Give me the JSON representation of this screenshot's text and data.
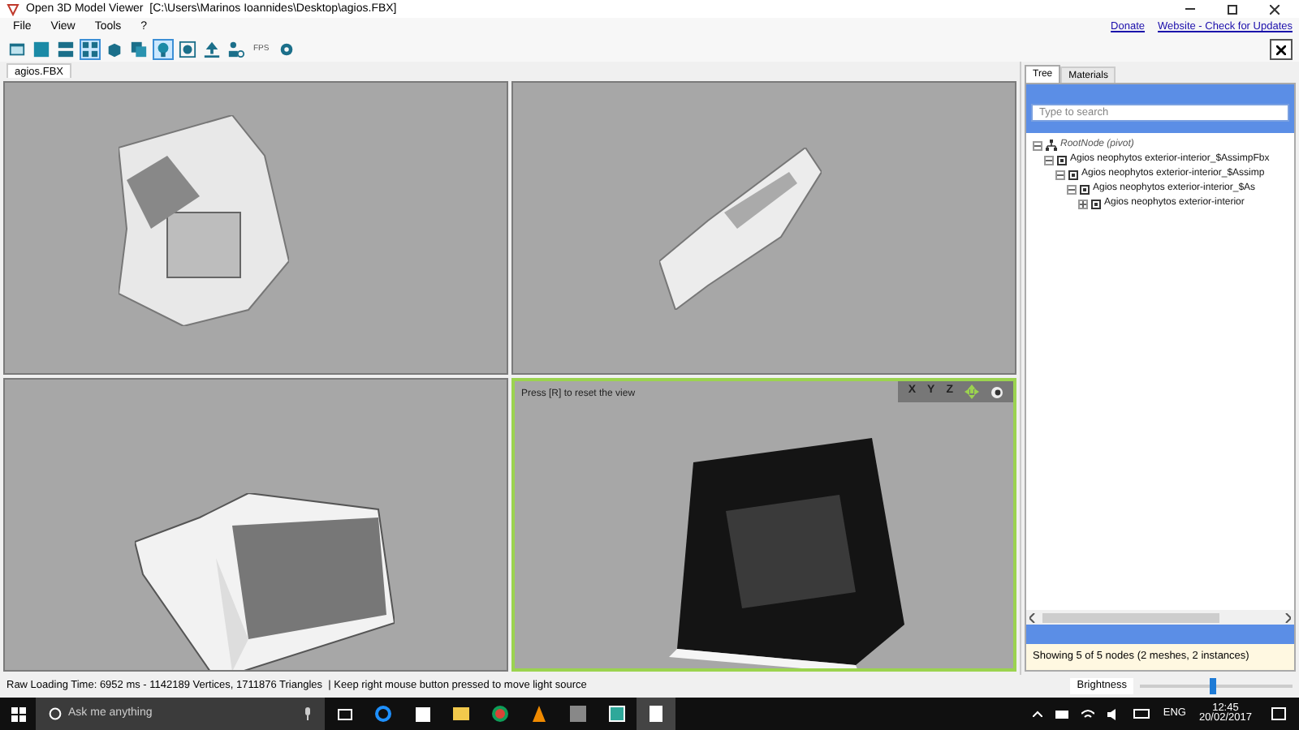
{
  "window": {
    "title": "Open 3D Model Viewer  [C:\\Users\\Marinos Ioannides\\Desktop\\agios.FBX]"
  },
  "menu": [
    "File",
    "View",
    "Tools",
    "?"
  ],
  "toolbar": [
    {
      "kind": "folder",
      "selected": false
    },
    {
      "kind": "single",
      "selected": false
    },
    {
      "kind": "double",
      "selected": false
    },
    {
      "kind": "quad",
      "selected": true
    },
    {
      "kind": "cube",
      "selected": false
    },
    {
      "kind": "cubes",
      "selected": false
    },
    {
      "kind": "bulb",
      "selected": true
    },
    {
      "kind": "frame",
      "selected": false
    },
    {
      "kind": "upload",
      "selected": false
    },
    {
      "kind": "person",
      "selected": false
    },
    {
      "kind": "text",
      "label": "FPS",
      "selected": false
    },
    {
      "kind": "gear",
      "selected": false
    }
  ],
  "links": [
    "Donate",
    "Website - Check for Updates"
  ],
  "document_tab": {
    "label": "agios.FBX"
  },
  "viewports": [
    {
      "active": false
    },
    {
      "active": false
    },
    {
      "active": false
    },
    {
      "active": true,
      "hint": "Press [R] to reset the view",
      "axes": [
        "X",
        "Y",
        "Z"
      ]
    }
  ],
  "panel": {
    "tabs": [
      {
        "label": "Tree",
        "selected": true
      },
      {
        "label": "Materials",
        "selected": false
      }
    ],
    "search": {
      "placeholder": "Type to search"
    },
    "tree": [
      {
        "label": "RootNode (pivot)",
        "kind": "root",
        "expanded": true,
        "children": [
          {
            "label": "Agios neophytos exterior-interior_$AssimpFbx",
            "kind": "node",
            "expanded": true,
            "children": [
              {
                "label": "Agios neophytos exterior-interior_$Assimp",
                "kind": "node",
                "expanded": true,
                "children": [
                  {
                    "label": "Agios neophytos exterior-interior_$As",
                    "kind": "node",
                    "expanded": true,
                    "children": [
                      {
                        "label": "Agios neophytos exterior-interior",
                        "kind": "node",
                        "expanded": false
                      }
                    ]
                  }
                ]
              }
            ]
          }
        ]
      }
    ],
    "summary": "Showing 5 of 5 nodes (2 meshes, 2 instances)"
  },
  "status_bar": {
    "text": "Raw Loading Time: 6952 ms - 1142189 Vertices, 1711876 Triangles  | Keep right mouse button pressed to move light source",
    "brightness_label": "Brightness",
    "level": 0.48
  },
  "taskbar": {
    "search_placeholder": "Ask me anything",
    "language": "ENG",
    "time": "12:45",
    "date": "20/02/2017"
  }
}
